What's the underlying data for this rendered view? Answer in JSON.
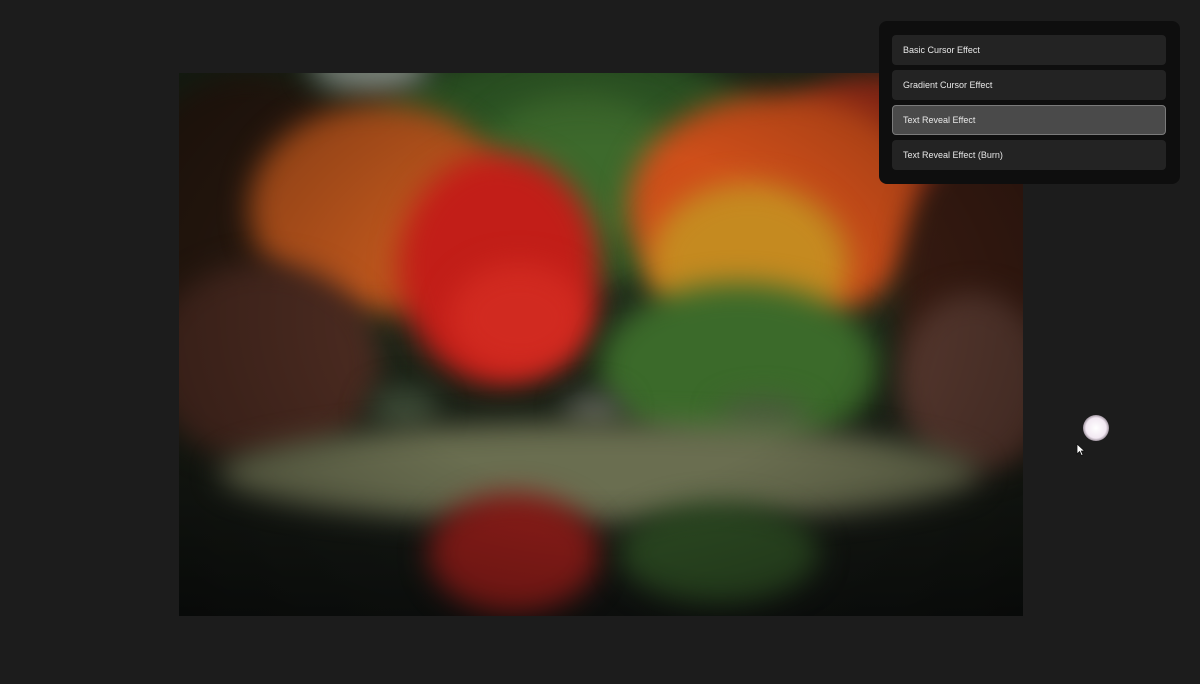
{
  "menu": {
    "items": [
      {
        "label": "Basic Cursor Effect"
      },
      {
        "label": "Gradient Cursor Effect"
      },
      {
        "label": "Text Reveal Effect"
      },
      {
        "label": "Text Reveal Effect (Burn)"
      }
    ],
    "selected_index": 2
  },
  "colors": {
    "page_background": "#1c1c1c",
    "panel_background": "#0e0e0e",
    "item_background": "#232323",
    "item_active_background": "#4a4a4a",
    "item_text": "#e8e8e8",
    "cursor_glow": "#f2e8f2"
  },
  "icons": {
    "cursor": "mouse-pointer-icon",
    "cursor_glow": "cursor-glow-effect"
  }
}
